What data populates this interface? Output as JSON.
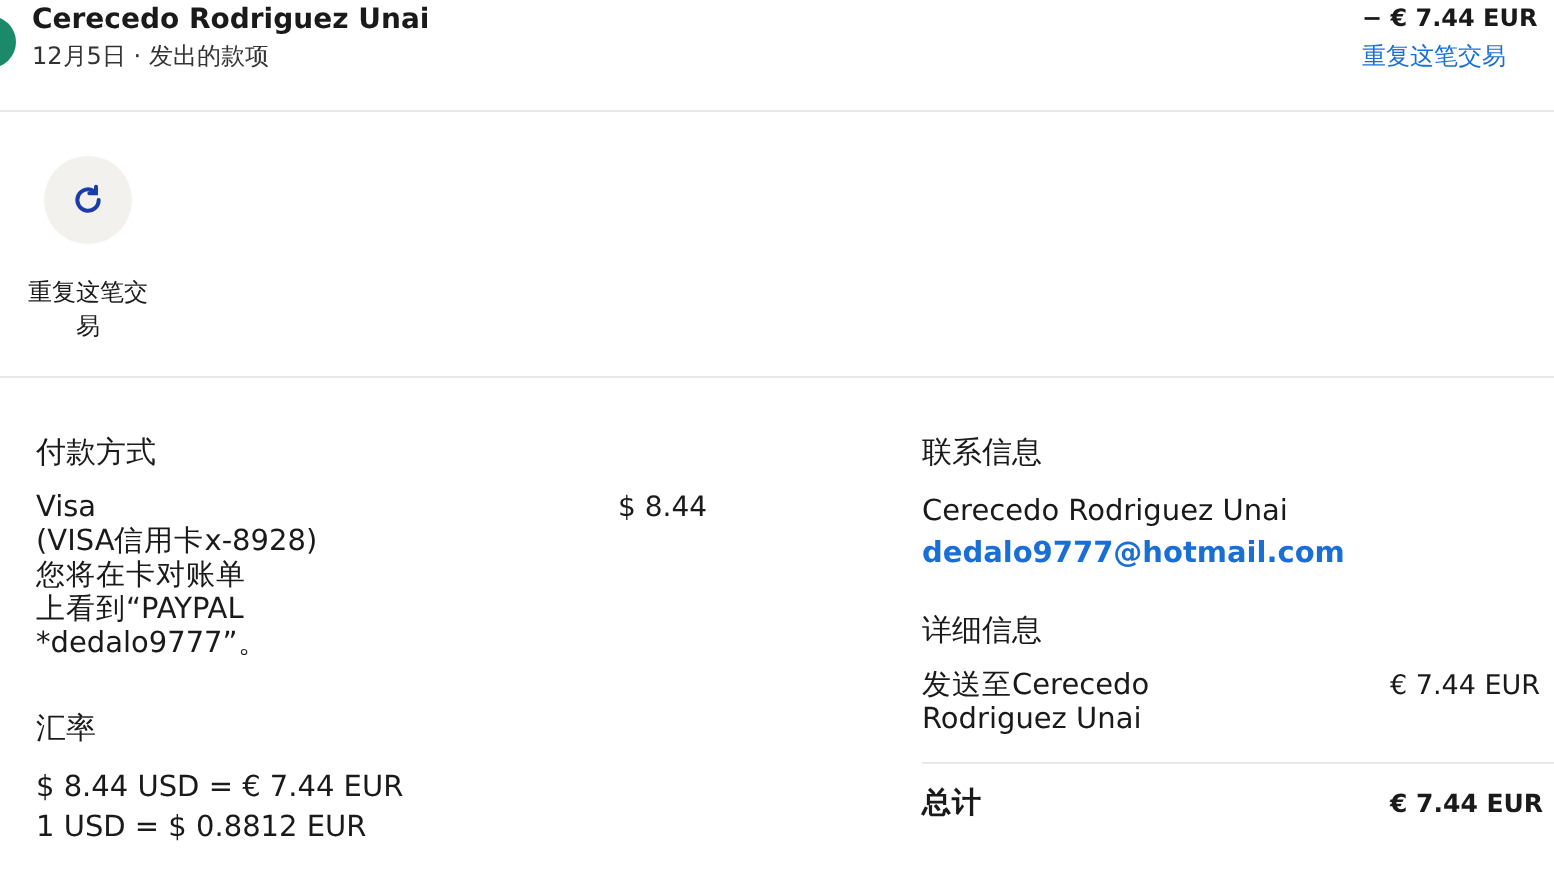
{
  "header": {
    "name": "Cerecedo Rodriguez Unai",
    "subtitle": "12月5日 · 发出的款项",
    "amount": "− € 7.44 EUR",
    "repeat_link": "重复这笔交易"
  },
  "actions": [
    {
      "label": "重复这笔交易"
    }
  ],
  "payment": {
    "heading": "付款方式",
    "lines": [
      "Visa",
      "(VISA信用卡x-8928)",
      "您将在卡对账单",
      "上看到“PAYPAL",
      "*dedalo9777”。"
    ],
    "amount": "$ 8.44"
  },
  "exchange": {
    "heading": "汇率",
    "lines": [
      "$ 8.44 USD = € 7.44 EUR",
      "1 USD = $ 0.8812 EUR"
    ]
  },
  "contact": {
    "heading": "联系信息",
    "name": "Cerecedo Rodriguez Unai",
    "email": "dedalo9777@hotmail.com"
  },
  "details": {
    "heading": "详细信息",
    "rows": [
      {
        "label": "发送至Cerecedo Rodriguez Unai",
        "value": "€ 7.44 EUR",
        "kind": "item"
      },
      {
        "label": "总计",
        "value": "€ 7.44 EUR",
        "kind": "total"
      }
    ]
  }
}
